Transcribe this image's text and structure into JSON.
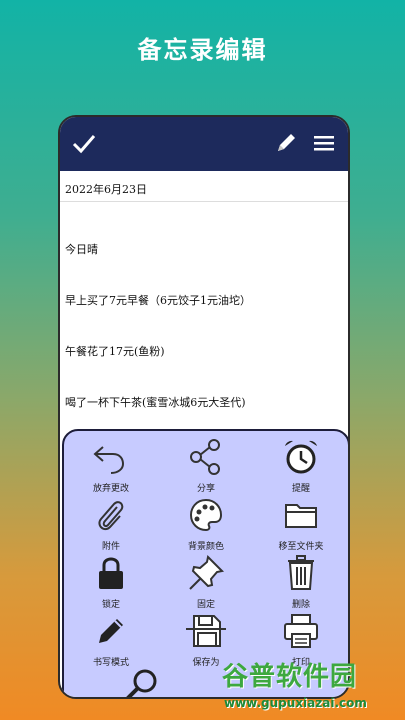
{
  "headline": "备忘录编辑",
  "toolbar": {
    "icons": [
      "check-icon",
      "pencil-icon",
      "menu-icon"
    ]
  },
  "note": {
    "date": "2022年6月23日",
    "lines": [
      "今日晴",
      "早上买了7元早餐（6元饺子1元油坨）",
      "午餐花了17元(鱼粉)",
      "喝了一杯下午茶(蜜雪冰城6元大圣代)",
      "……",
      "…"
    ]
  },
  "actions": [
    {
      "label": "放弃更改",
      "icon": "undo-icon"
    },
    {
      "label": "分享",
      "icon": "share-icon"
    },
    {
      "label": "提醒",
      "icon": "alarm-icon"
    },
    {
      "label": "附件",
      "icon": "paperclip-icon"
    },
    {
      "label": "背景颜色",
      "icon": "palette-icon"
    },
    {
      "label": "移至文件夹",
      "icon": "folder-icon"
    },
    {
      "label": "锁定",
      "icon": "lock-icon"
    },
    {
      "label": "固定",
      "icon": "pin-icon"
    },
    {
      "label": "删除",
      "icon": "trash-icon"
    },
    {
      "label": "书写模式",
      "icon": "pencil-icon"
    },
    {
      "label": "保存为",
      "icon": "save-icon"
    },
    {
      "label": "打印",
      "icon": "print-icon"
    }
  ],
  "watermark": {
    "title": "谷普软件园",
    "url": "www.gupuxiazai.com"
  }
}
